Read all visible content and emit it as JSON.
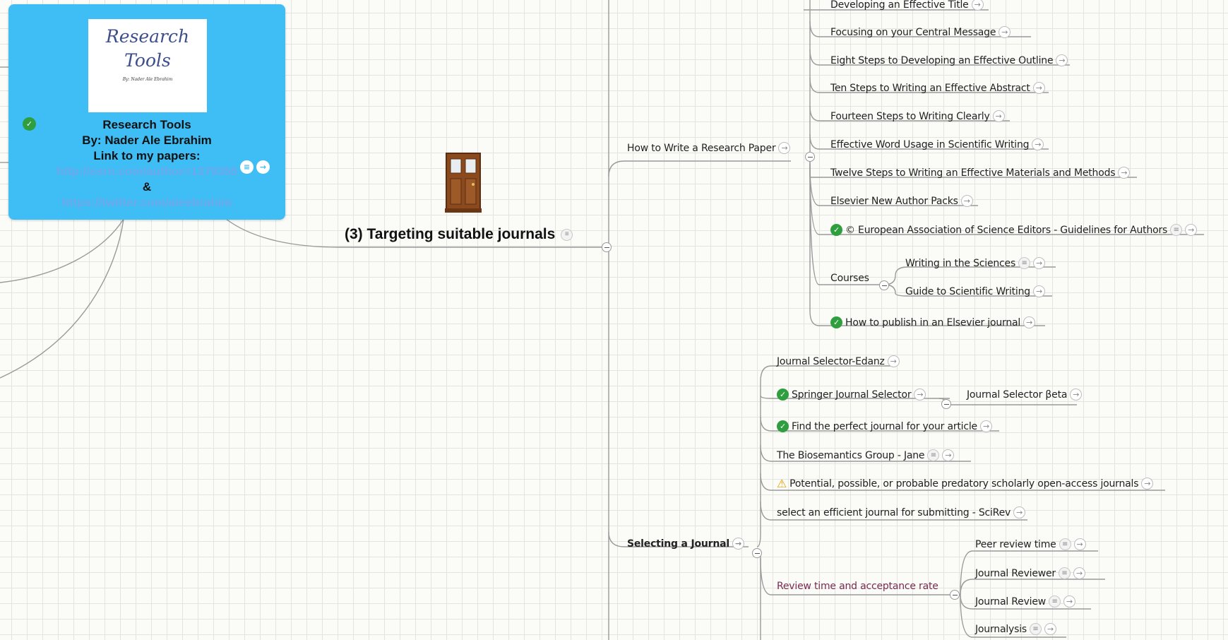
{
  "central_card": {
    "logo_title_line1": "Research",
    "logo_title_line2": "Tools",
    "logo_subtitle": "By: Nader Ale Ebrahim",
    "line1": "Research Tools",
    "line2": "By: Nader Ale Ebrahim",
    "line3": "Link to my papers:",
    "link1": "http://ssrn.com/author=1379350",
    "ampersand": "&",
    "link2": "https://twitter.com/aleebrahim"
  },
  "main_topic": {
    "label": "(3) Targeting suitable journals"
  },
  "write_paper": {
    "label": "How to Write a Research Paper",
    "items": {
      "title": "Developing an Effective Title",
      "central": "Focusing on your Central Message",
      "outline": "Eight Steps to Developing an Effective Outline",
      "abstract": "Ten Steps to Writing an Effective Abstract",
      "clearly": "Fourteen Steps to Writing Clearly",
      "word_usage": "Effective Word Usage in Scientific Writing",
      "methods": "Twelve Steps to Writing an Effective Materials and Methods",
      "packs": "Elsevier New Author Packs",
      "ease": "© European Association of Science Editors - Guidelines for Authors",
      "courses": "Courses",
      "sciences": "Writing in the Sciences",
      "guide": "Guide to Scientific Writing",
      "publish": "How to publish in an Elsevier journal"
    }
  },
  "selecting": {
    "label": "Selecting a Journal",
    "items": {
      "edanz": "Journal Selector-Edanz",
      "springer": "Springer Journal Selector",
      "springer_beta": "Journal Selector βeta",
      "perfect": "Find the perfect journal for your article",
      "jane": "The Biosemantics Group - Jane",
      "predatory": "Potential, possible, or probable predatory scholarly open-access journals",
      "scirev": "select an efficient journal for submitting - SciRev",
      "review_rate": "Review time and acceptance rate",
      "peer_review": "Peer review time",
      "reviewer": "Journal Reviewer",
      "journal_review": "Journal Review",
      "journalysis": "Journalysis"
    }
  },
  "colors": {
    "card": "#3fbdf5",
    "link": "#6da8ec",
    "check": "#2e9e3e",
    "review_rate": "#7a2a52",
    "warning": "#e0a000"
  },
  "icons": {
    "arrow": "arrow-right-icon",
    "note": "note-icon",
    "check": "check-icon",
    "warning": "warning-icon",
    "door": "door-icon"
  }
}
